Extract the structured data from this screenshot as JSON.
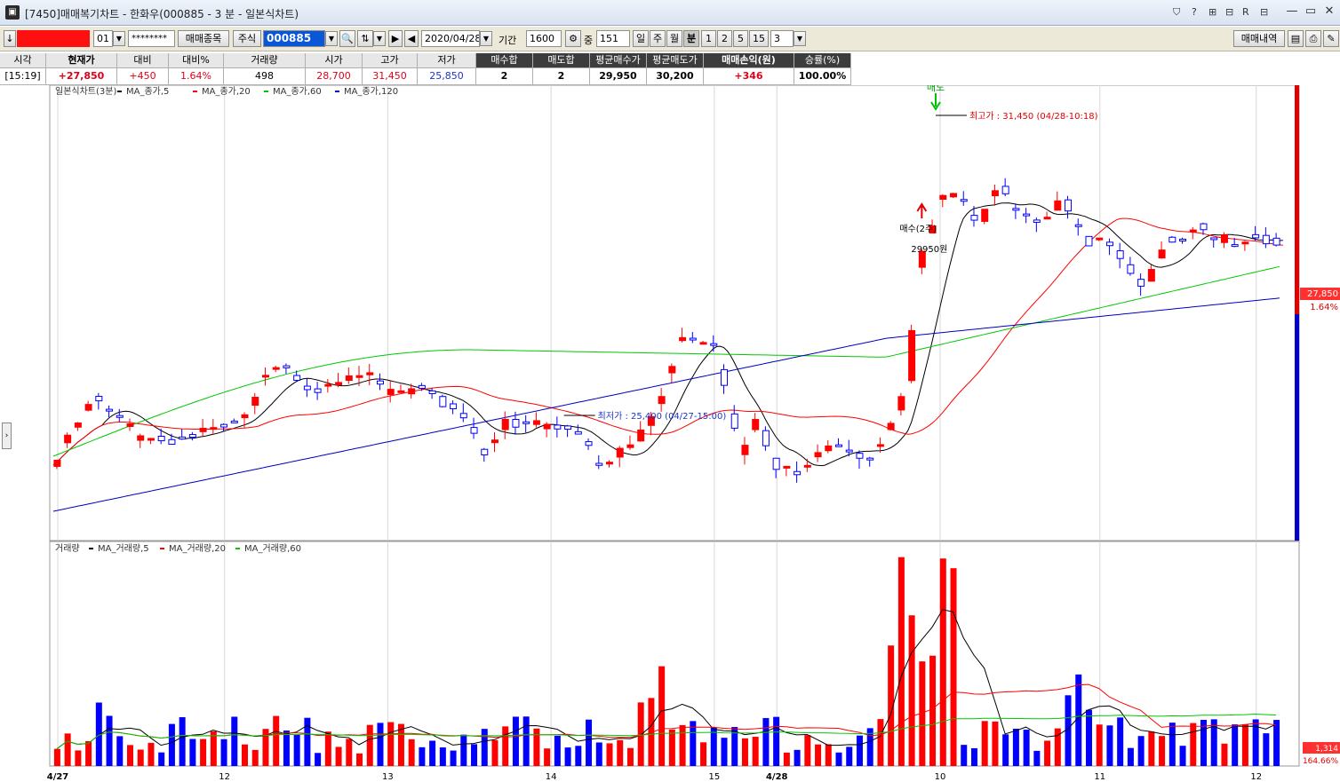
{
  "window": {
    "title": "[7450]매매복기차트 - 한화우(000885 - 3 분 - 일본식차트)",
    "buttons": [
      "⛉",
      "?",
      "⊞",
      "R",
      "⊟",
      "▭",
      "✕"
    ]
  },
  "toolbar": {
    "arrow_label": "↓",
    "account_no": "",
    "account_suffix": "01",
    "password": "********",
    "trade_items_button": "매매종목",
    "market_label": "주식",
    "stock_code": "000885",
    "date": "2020/04/28",
    "period_label": "기간",
    "period_value": "1600",
    "compress_label": "중",
    "compress_value": "151",
    "periods": [
      "일",
      "주",
      "월",
      "분",
      "1",
      "2",
      "5",
      "15",
      "3"
    ],
    "active_period": "분",
    "history_button": "매매내역"
  },
  "info": {
    "headers": [
      "시각",
      "현재가",
      "대비",
      "대비%",
      "거래량",
      "시가",
      "고가",
      "저가",
      "매수합",
      "매도합",
      "평균매수가",
      "평균매도가",
      "매매손익(원)",
      "승률(%)"
    ],
    "values": [
      "[15:19]",
      "+27,850",
      "+450",
      "1.64%",
      "498",
      "28,700",
      "31,450",
      "25,850",
      "2",
      "2",
      "29,950",
      "30,200",
      "+346",
      "100.00%"
    ]
  },
  "chart_data": {
    "type": "candlestick",
    "price_legend": [
      "일본식차트(3분)",
      "MA_종가,5",
      "MA_종가,20",
      "MA_종가,60",
      "MA_종가,120"
    ],
    "volume_legend": [
      "거래량",
      "MA_거래량,5",
      "MA_거래량,20",
      "MA_거래량,60"
    ],
    "x_ticks": [
      "4/27",
      "12",
      "13",
      "14",
      "15",
      "4/28",
      "10",
      "11",
      "12"
    ],
    "y_range": [
      24400,
      31900
    ],
    "volume_max": 3500,
    "high_annotation": "최고가 : 31,450 (04/28-10:18)",
    "low_annotation": "최저가 : 25,400 (04/27-15:00)",
    "sell_marker": "매도",
    "buy_marker": [
      "매수(2주)",
      "29950원"
    ],
    "price_tag": "27,850",
    "pct_tag": "1.64%",
    "volume_tag": "1,314",
    "volume_pct_tag": "164.66%",
    "colors": {
      "up": "#ff0000",
      "down": "#0000ff",
      "ma5": "#000000",
      "ma20": "#ff0000",
      "ma60": "#00c800",
      "ma120": "#0000c0"
    }
  }
}
